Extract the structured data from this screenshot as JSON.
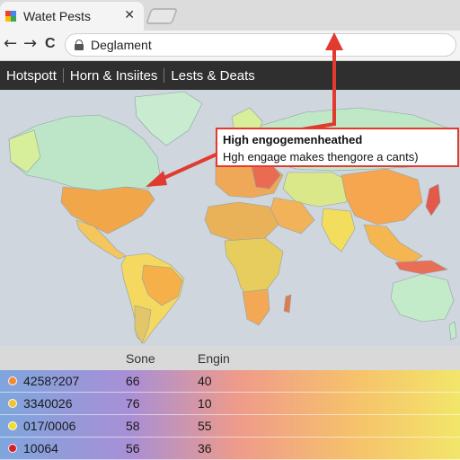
{
  "browser": {
    "tab_title": "Watet Pests",
    "tab_close": "✕",
    "url": "Deglament",
    "back": "←",
    "forward": "→",
    "reload": "C"
  },
  "app_nav": {
    "items": [
      "Hotspott",
      "Horn & Insiites",
      "Lests & Deats"
    ]
  },
  "tooltip": {
    "title": "High engogemenheathed",
    "body": "Hgh engage makes thengore a cants)"
  },
  "table": {
    "columns": [
      "Sone",
      "Engin"
    ],
    "rows": [
      {
        "id": "4258?207",
        "sone": "66",
        "engin": "40",
        "dot_color": "#f08a3c"
      },
      {
        "id": "3340026",
        "sone": "76",
        "engin": "10",
        "dot_color": "#f1c232"
      },
      {
        "id": "017/0006",
        "sone": "58",
        "engin": "55",
        "dot_color": "#f2dd2e"
      },
      {
        "id": "10064",
        "sone": "56",
        "engin": "36",
        "dot_color": "#d3202a"
      }
    ]
  },
  "colors": {
    "accent_red": "#e13b2f",
    "nav_bg": "#2f2f2f",
    "ocean": "#cfd6dd"
  },
  "icons": [
    "favicon-icon",
    "close-icon",
    "back-arrow-icon",
    "forward-arrow-icon",
    "reload-icon",
    "lock-icon",
    "arrow-annotation-icon"
  ]
}
